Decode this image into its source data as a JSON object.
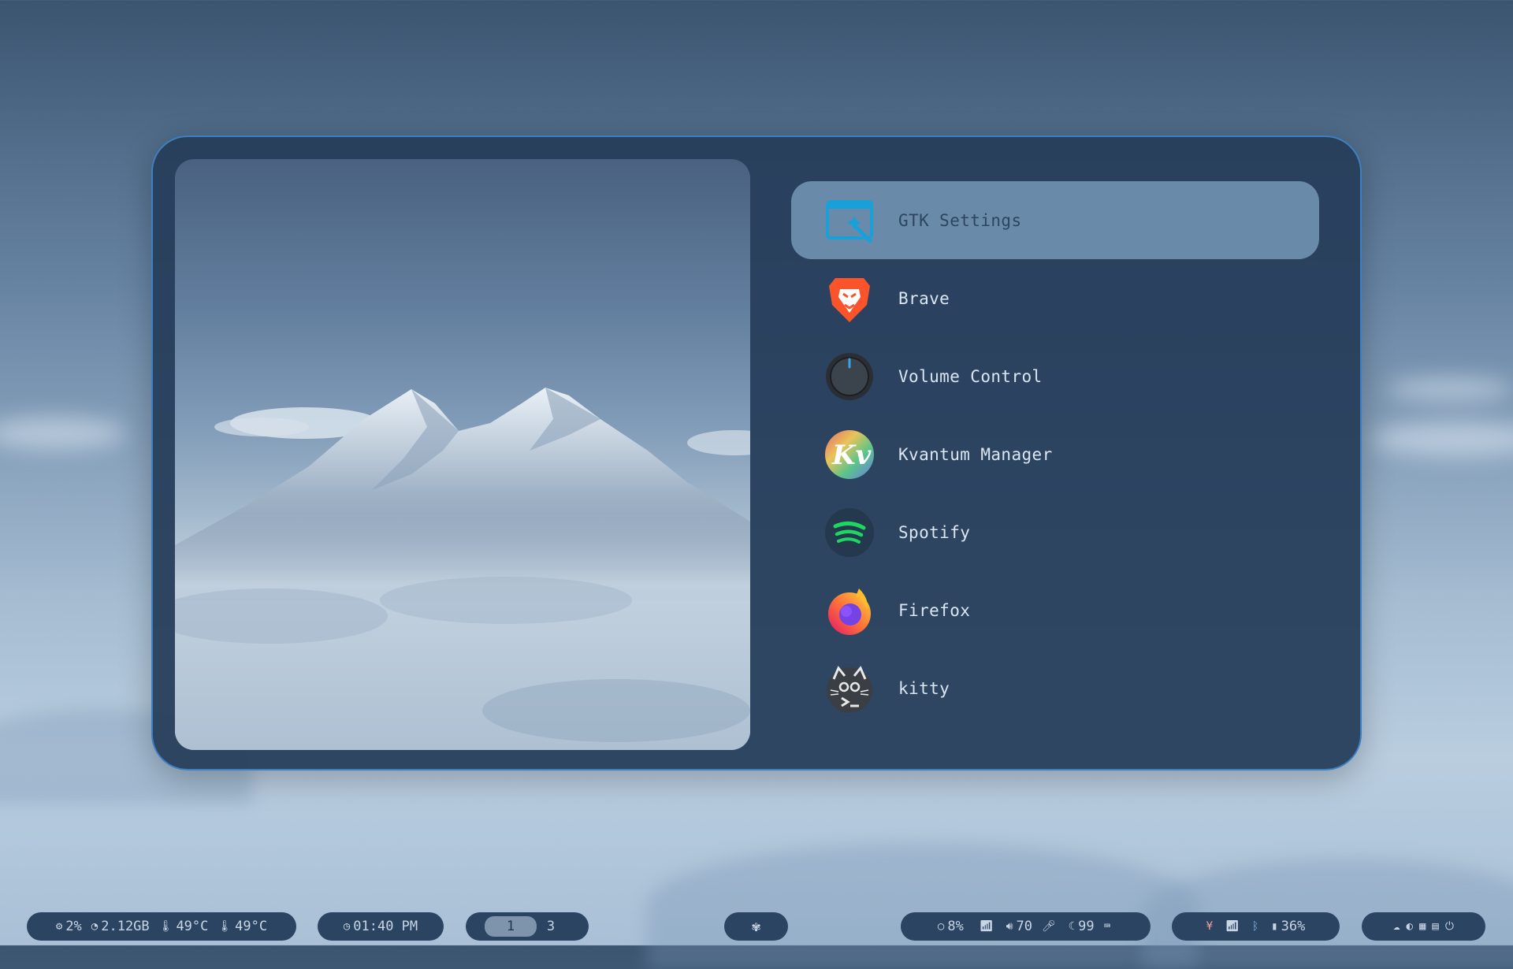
{
  "launcher": {
    "apps": [
      {
        "label": "GTK Settings",
        "icon": "gtk-settings-icon",
        "selected": true
      },
      {
        "label": "Brave",
        "icon": "brave-icon",
        "selected": false
      },
      {
        "label": "Volume Control",
        "icon": "volume-knob-icon",
        "selected": false
      },
      {
        "label": "Kvantum Manager",
        "icon": "kvantum-icon",
        "selected": false
      },
      {
        "label": "Spotify",
        "icon": "spotify-icon",
        "selected": false
      },
      {
        "label": "Firefox",
        "icon": "firefox-icon",
        "selected": false
      },
      {
        "label": "kitty",
        "icon": "kitty-icon",
        "selected": false
      }
    ]
  },
  "bar": {
    "system": {
      "cpu": "2%",
      "memory": "2.12GB",
      "temp1": "49°C",
      "temp2": "49°C"
    },
    "clock": {
      "time": "01:40 PM"
    },
    "workspaces": {
      "active": "1",
      "other": "3"
    },
    "status": {
      "brightness": "8%",
      "volume": "70",
      "moon_value": "99"
    },
    "tray": {
      "battery": "36%"
    }
  },
  "colors": {
    "accent": "#3d7fc0",
    "panel": "#263e5a",
    "selected": "#6a8aa9",
    "bar": "#2b4461"
  }
}
